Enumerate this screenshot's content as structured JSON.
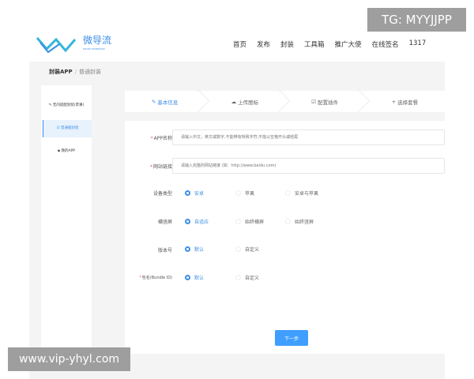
{
  "header": {
    "logo_text": "微导流",
    "logo_sub": "MICRO DIVERSION",
    "nav": [
      "首页",
      "发布",
      "封装",
      "工具箱",
      "推广大使",
      "在线签名",
      "1317"
    ]
  },
  "breadcrumb": {
    "root": "封装APP",
    "sep": "/",
    "current": "普通封装"
  },
  "sidebar": {
    "items": [
      {
        "label": "无闪适配封装(苹果)",
        "icon": "edit-icon"
      },
      {
        "label": "普通版封装",
        "icon": "edit-square-icon"
      },
      {
        "label": "我的APP",
        "icon": "grid-icon"
      }
    ]
  },
  "steps": [
    {
      "label": "基本信息",
      "icon": "✎"
    },
    {
      "label": "上传图标",
      "icon": "☁"
    },
    {
      "label": "配置插件",
      "icon": "☑"
    },
    {
      "label": "选择套餐",
      "icon": "+"
    }
  ],
  "form": {
    "app_name": {
      "label": "APP名称",
      "placeholder": "请输入中文，英文或数字,不能带有特殊字符,不能以空格开头或结尾"
    },
    "site_url": {
      "label": "网站链接",
      "placeholder": "请输入完整的网站链接 (如：http://www.baidu.com)"
    },
    "device": {
      "label": "设备类型",
      "options": [
        "安卓",
        "苹果",
        "安卓与苹果"
      ]
    },
    "orientation": {
      "label": "横竖屏",
      "options": [
        "自适应",
        "始终横屏",
        "始终竖屏"
      ]
    },
    "version": {
      "label": "版本号",
      "options": [
        "默认",
        "自定义"
      ]
    },
    "bundle": {
      "label": "包名(Bundle ID)",
      "options": [
        "默认",
        "自定义"
      ]
    },
    "next": "下一步"
  },
  "watermarks": {
    "top": "TG: MYYJJPP",
    "bottom": "www.vip-yhyl.com"
  },
  "colors": {
    "accent": "#409eff"
  }
}
